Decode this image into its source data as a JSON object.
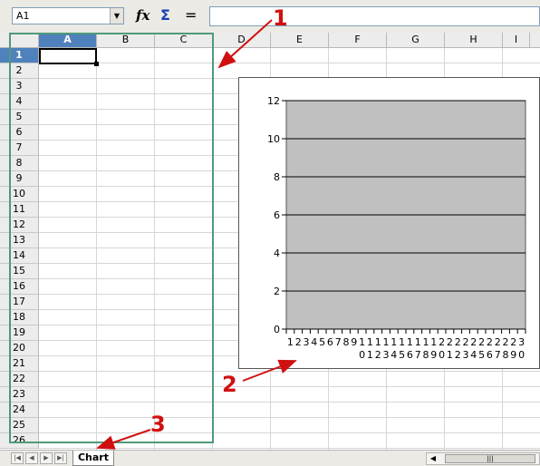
{
  "formula_bar": {
    "name_box": "A1",
    "function_wizard_icon": "fx",
    "sum_icon": "Σ",
    "equals_icon": "=",
    "formula_value": ""
  },
  "columns": [
    "A",
    "B",
    "C",
    "D",
    "E",
    "F",
    "G",
    "H",
    "I"
  ],
  "active_column": "A",
  "rows": [
    "1",
    "2",
    "3",
    "4",
    "5",
    "6",
    "7",
    "8",
    "9",
    "10",
    "11",
    "12",
    "13",
    "14",
    "15",
    "16",
    "17",
    "18",
    "19",
    "20",
    "21",
    "22",
    "23",
    "24",
    "25",
    "26"
  ],
  "active_row": "1",
  "chart_data": {
    "type": "bar",
    "title": "",
    "xlabel": "",
    "ylabel": "",
    "ylim": [
      0,
      12
    ],
    "yticks": [
      "0",
      "2",
      "4",
      "6",
      "8",
      "10",
      "12"
    ],
    "categories": [
      "1",
      "2",
      "3",
      "4",
      "5",
      "6",
      "7",
      "8",
      "9",
      "10",
      "11",
      "12",
      "13",
      "14",
      "15",
      "16",
      "17",
      "18",
      "19",
      "20",
      "21",
      "22",
      "23",
      "24",
      "25",
      "26",
      "27",
      "28",
      "29",
      "30"
    ],
    "series": [],
    "grid": true,
    "plot_area_color": "#c0c0c0"
  },
  "sheet_tabs": [
    "Chart"
  ],
  "active_sheet": "Chart",
  "annotations": [
    "1",
    "2",
    "3"
  ],
  "colors": {
    "selection_accent": "#4f81bd",
    "outline_green": "#4f9a78",
    "annotation_red": "#d01010"
  }
}
